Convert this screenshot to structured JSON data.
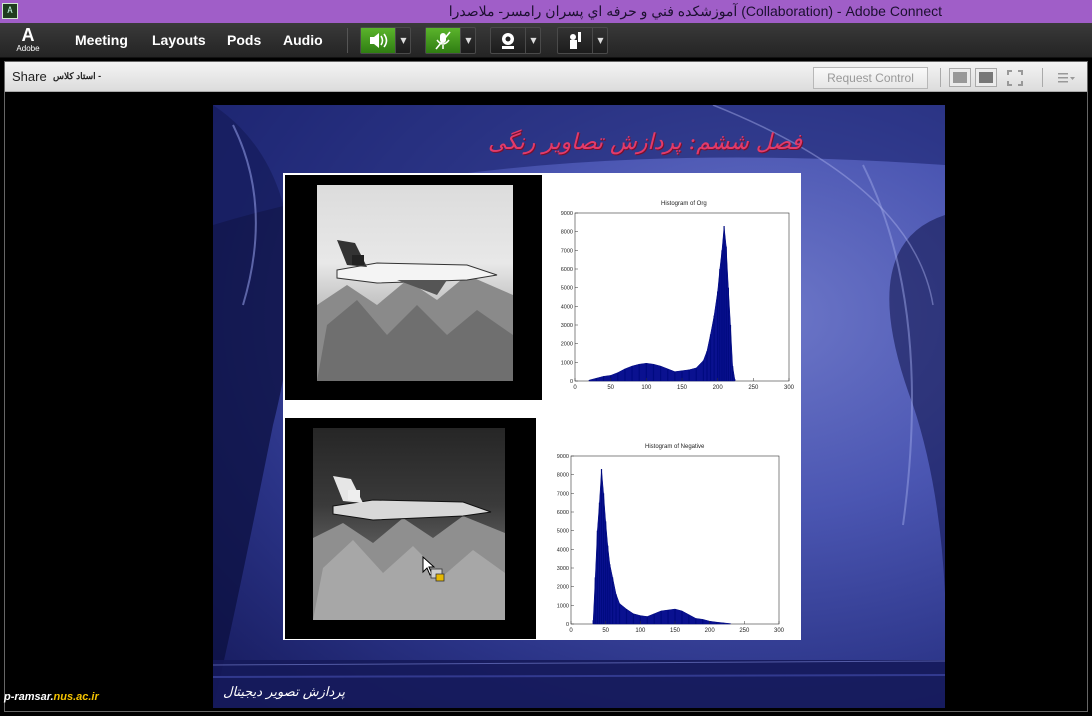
{
  "window": {
    "title": "آموزشکده فني و حرفه اي پسران رامسر- ملاصدرا (Collaboration) - Adobe Connect",
    "app_icon": "adobe-connect-icon"
  },
  "menubar": {
    "logo_text": "Adobe",
    "items": [
      "Meeting",
      "Layouts",
      "Pods",
      "Audio"
    ],
    "speaker_state": "on",
    "mic_state": "muted"
  },
  "share_pod": {
    "title": "Share",
    "presenter": "استاد کلاس -",
    "request_control_label": "Request Control"
  },
  "slide": {
    "title": "فصل ششم: پردازش تصاویر رنگی",
    "footer": "پردازش تصویر دیجیتال"
  },
  "chart_data": [
    {
      "type": "bar",
      "title": "Histogram of Org",
      "x_ticks": [
        0,
        50,
        100,
        150,
        200,
        250,
        300
      ],
      "y_ticks": [
        0,
        1000,
        2000,
        3000,
        4000,
        5000,
        6000,
        7000,
        8000,
        9000
      ],
      "xlim": [
        0,
        300
      ],
      "ylim": [
        0,
        9000
      ],
      "x": [
        20,
        30,
        40,
        50,
        60,
        70,
        80,
        90,
        100,
        110,
        120,
        130,
        140,
        150,
        160,
        170,
        180,
        185,
        190,
        195,
        200,
        203,
        206,
        209,
        212,
        215,
        218,
        221,
        224
      ],
      "values": [
        50,
        150,
        250,
        300,
        450,
        650,
        800,
        900,
        950,
        900,
        800,
        650,
        500,
        550,
        600,
        700,
        1100,
        1600,
        2500,
        3500,
        4800,
        6000,
        7000,
        8300,
        7200,
        5000,
        3000,
        800,
        100
      ]
    },
    {
      "type": "bar",
      "title": "Histogram of Negative",
      "x_ticks": [
        0,
        50,
        100,
        150,
        200,
        250,
        300
      ],
      "y_ticks": [
        0,
        1000,
        2000,
        3000,
        4000,
        5000,
        6000,
        7000,
        8000,
        9000
      ],
      "xlim": [
        0,
        300
      ],
      "ylim": [
        0,
        9000
      ],
      "x": [
        32,
        35,
        38,
        41,
        44,
        47,
        50,
        53,
        56,
        60,
        65,
        70,
        80,
        90,
        100,
        110,
        120,
        130,
        140,
        150,
        160,
        170,
        180,
        190,
        200,
        210,
        220,
        230
      ],
      "values": [
        200,
        2500,
        5000,
        6500,
        8300,
        7000,
        5500,
        4200,
        3200,
        2500,
        1600,
        1100,
        800,
        550,
        450,
        400,
        550,
        700,
        750,
        800,
        700,
        500,
        300,
        250,
        150,
        100,
        60,
        20
      ]
    }
  ],
  "watermark": {
    "prefix": "p-ramsar.",
    "domain": "nus.ac.ir"
  }
}
